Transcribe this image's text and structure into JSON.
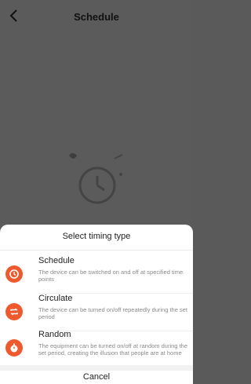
{
  "header": {
    "title": "Schedule",
    "back_icon": "chevron-left-icon"
  },
  "sheet": {
    "title": "Select timing type",
    "options": [
      {
        "name": "Schedule",
        "description": "The device can be switched on and off at specified time points",
        "icon": "clock-icon"
      },
      {
        "name": "Circulate",
        "description": "The device can be turned on/off repeatedly during the set period",
        "icon": "repeat-icon"
      },
      {
        "name": "Random",
        "description": "The equipment can be turned on/off at random during the set period, creating the illusion that people are at home",
        "icon": "timer-icon"
      }
    ],
    "cancel_label": "Cancel"
  },
  "colors": {
    "accent": "#ee5a2e",
    "overlay": "#5b5b5b"
  }
}
